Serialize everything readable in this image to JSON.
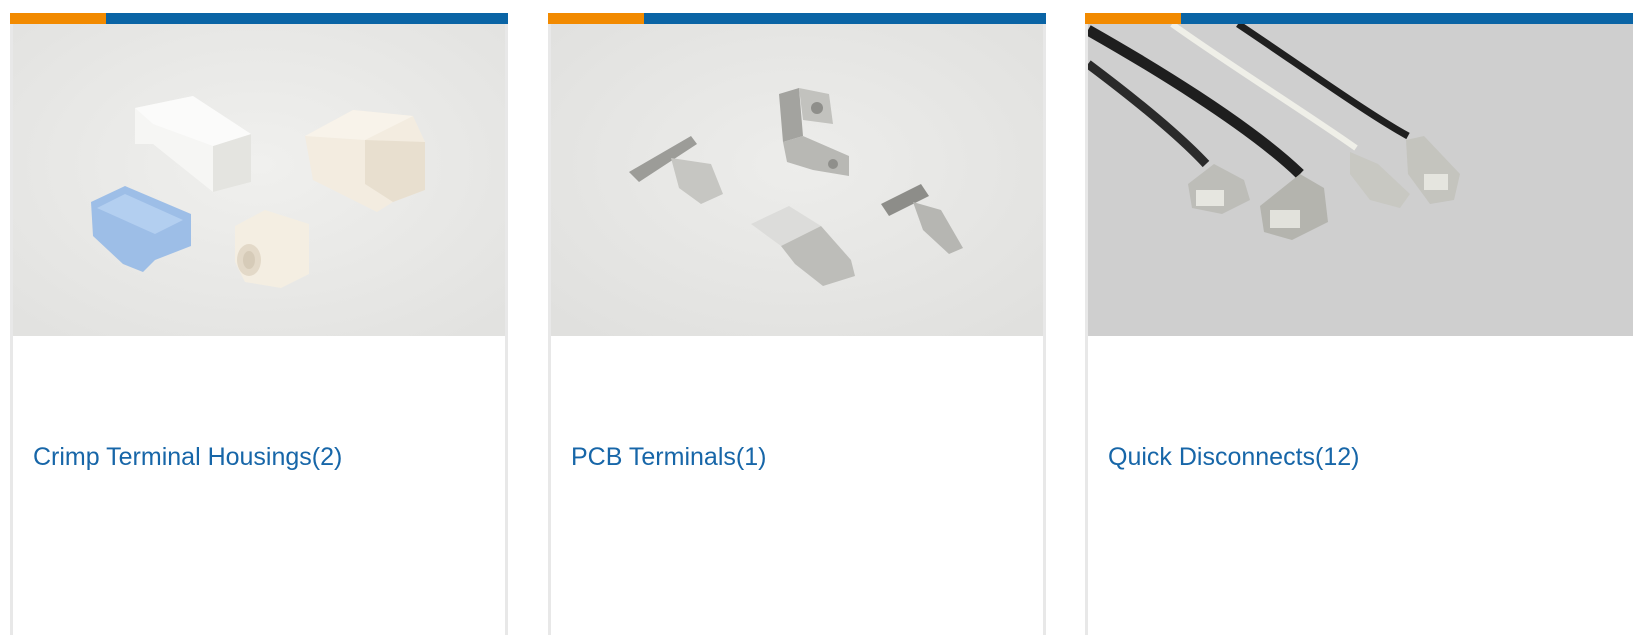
{
  "colors": {
    "accent_orange": "#f28a00",
    "bar_blue": "#0a64a5",
    "link_blue": "#1766a8"
  },
  "cards": [
    {
      "title": "Crimp Terminal Housings(2)"
    },
    {
      "title": "PCB Terminals(1)"
    },
    {
      "title": "Quick Disconnects(12)"
    }
  ]
}
